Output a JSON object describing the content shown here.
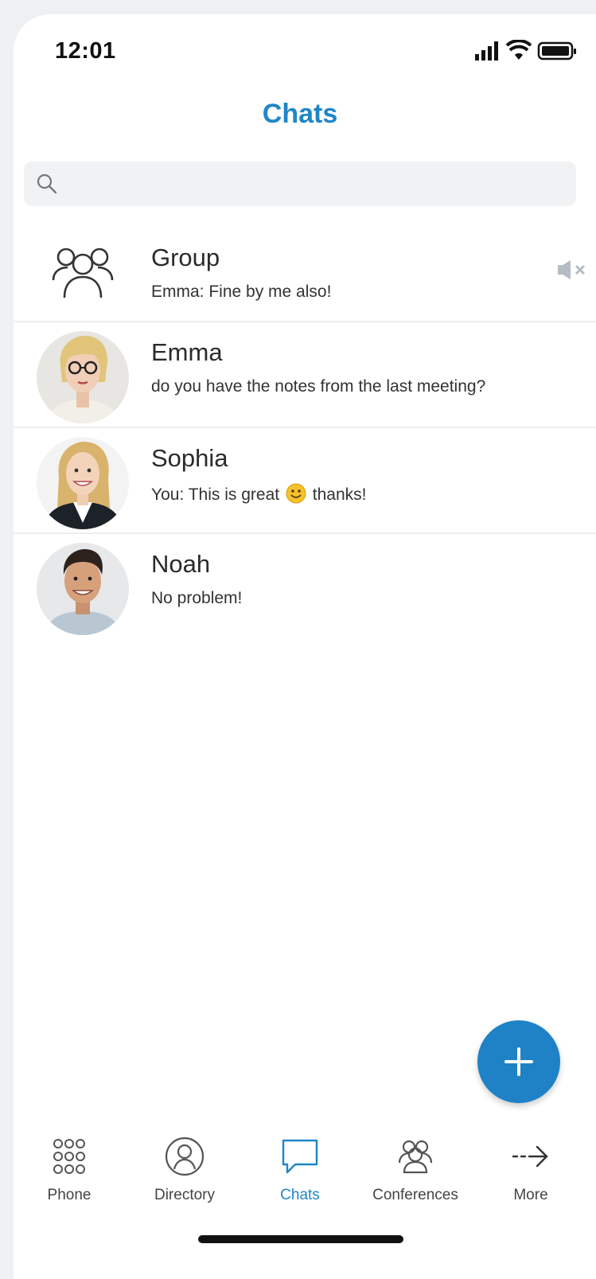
{
  "status_bar": {
    "time": "12:01"
  },
  "header": {
    "title": "Chats"
  },
  "search": {
    "placeholder": ""
  },
  "chats": [
    {
      "name": "Group",
      "preview": "Emma: Fine by me also!",
      "muted": true,
      "avatar": "group-icon"
    },
    {
      "name": "Emma",
      "preview": "do you have the notes from the last meeting?",
      "avatar": "photo"
    },
    {
      "name": "Sophia",
      "preview_before": "You: This is great",
      "preview_emoji": "smiley-emoji",
      "preview_after": "thanks!",
      "avatar": "photo"
    },
    {
      "name": "Noah",
      "preview": "No problem!",
      "avatar": "photo"
    }
  ],
  "fab": {
    "icon": "plus-icon"
  },
  "tabs": [
    {
      "label": "Phone",
      "icon": "dialpad-icon"
    },
    {
      "label": "Directory",
      "icon": "person-circle-icon"
    },
    {
      "label": "Chats",
      "icon": "chat-bubble-icon",
      "active": true
    },
    {
      "label": "Conferences",
      "icon": "people-icon"
    },
    {
      "label": "More",
      "icon": "arrow-right-icon"
    }
  ],
  "colors": {
    "accent": "#1f86c8",
    "fab": "#1f82c6",
    "search_bg": "#f1f2f3"
  }
}
